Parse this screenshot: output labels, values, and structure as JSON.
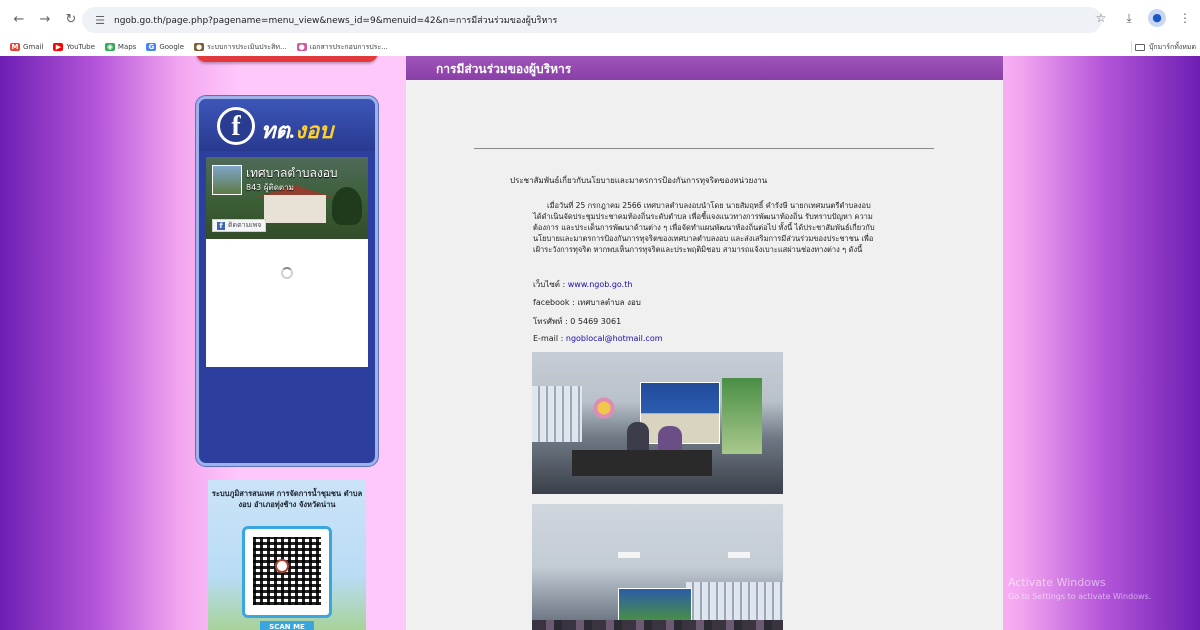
{
  "browser": {
    "url": "ngob.go.th/page.php?pagename=menu_view&news_id=9&menuid=42&n=การมีส่วนร่วมของผู้บริหาร",
    "icons": [
      "back-icon",
      "forward-icon",
      "reload-icon",
      "site-settings-icon",
      "star-icon",
      "download-icon",
      "profile-icon",
      "more-icon"
    ]
  },
  "bookmarks": {
    "items": [
      {
        "label": "Gmail",
        "icon": "gmail-icon",
        "color": "#ea4335"
      },
      {
        "label": "YouTube",
        "icon": "youtube-icon",
        "color": "#ff0000"
      },
      {
        "label": "Maps",
        "icon": "maps-icon",
        "color": "#34a853"
      },
      {
        "label": "Google",
        "icon": "google-icon",
        "color": "#4285f4"
      },
      {
        "label": "ระบบการประเมินประสิท...",
        "icon": "site-icon",
        "color": "#7a5c2e"
      },
      {
        "label": "เอกสารประกอบการประ...",
        "icon": "site-icon",
        "color": "#d45aa0"
      }
    ],
    "right_label": "บุ๊กมาร์กทั้งหมด"
  },
  "sidebar": {
    "fb_title_prefix": "ทต.",
    "fb_title_accent": "งอบ",
    "fb_page_name": "เทศบาลตำบลงอบ",
    "fb_followers": "843 ผู้ติดตาม",
    "fb_follow_button": "ติดตามเพจ",
    "qr_title": "ระบบภูมิสารสนเทศ การจัดการน้ำชุมชน ตำบลงอบ อำเภอทุ่งช้าง จังหวัดน่าน",
    "qr_scan": "SCAN ME"
  },
  "content": {
    "header": "การมีส่วนร่วมของผู้บริหาร",
    "lead": "ประชาสัมพันธ์เกี่ยวกับนโยบายและมาตรการป้องกันการทุจริตของหน่วยงาน",
    "paragraph": "เมื่อวันที่ 25 กรกฎาคม 2566 เทศบาลตำบลงอบนำโดย นายสัมฤทธิ์ คำรังษี นายกเทศมนตรีตำบลงอบ ได้ดำเนินจัดประชุมประชาคมท้องถิ่นระดับตำบล เพื่อชี้แจงแนวทางการพัฒนาท้องถิ่น รับทราบปัญหา ความต้องการ และประเด็นการพัฒนาด้านต่าง ๆ เพื่อจัดทำแผนพัฒนาท้องถิ่นต่อไป ทั้งนี้ ได้ประชาสัมพันธ์เกี่ยวกับนโยบายและมาตรการป้องกันการทุจริตของเทศบาลตำบลงอบ และส่งเสริมการมีส่วนร่วมของประชาชน เพื่อเฝ้าระวังการทุจริต หากพบเห็นการทุจริตและประพฤติมิชอบ สามารถแจ้งเบาะแสผ่านช่องทางต่าง ๆ ดังนี้",
    "website_label": "เว็บไซต์ :",
    "website": "www.ngob.go.th",
    "facebook": "facebook : เทศบาลตำบล งอบ",
    "phone": "โทรศัพท์ : 0 5469 3061",
    "email_label": "E-mail :",
    "email": "ngoblocal@hotmail.com"
  },
  "os": {
    "watermark_title": "Activate Windows",
    "watermark_sub": "Go to Settings to activate Windows."
  },
  "colors": {
    "header_purple": "#9e54b9",
    "fb_blue": "#2c3e9e",
    "link_blue": "#1a0dab"
  }
}
